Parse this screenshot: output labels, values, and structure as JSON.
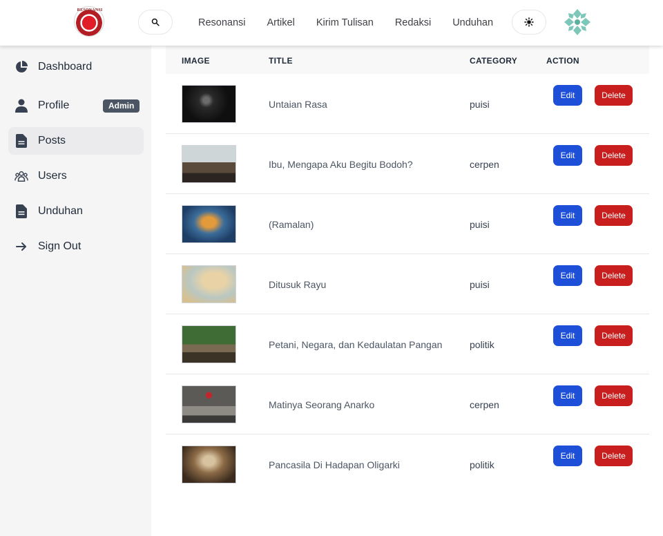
{
  "header": {
    "logo_text": "RESONANSI",
    "nav": [
      "Resonansi",
      "Artikel",
      "Kirim Tulisan",
      "Redaksi",
      "Unduhan"
    ],
    "icons": {
      "search": "search-icon",
      "theme": "sun-icon",
      "avatar": "avatar-icon"
    }
  },
  "sidebar": {
    "items": [
      {
        "label": "Dashboard",
        "icon": "pie-chart-icon"
      },
      {
        "label": "Profile",
        "icon": "user-icon",
        "badge": "Admin"
      },
      {
        "label": "Posts",
        "icon": "document-icon",
        "active": true
      },
      {
        "label": "Users",
        "icon": "users-icon"
      },
      {
        "label": "Unduhan",
        "icon": "file-icon"
      },
      {
        "label": "Sign Out",
        "icon": "arrow-right-icon"
      }
    ]
  },
  "table": {
    "headers": {
      "image": "IMAGE",
      "title": "TITLE",
      "category": "CATEGORY",
      "action": "ACTION"
    },
    "edit_label": "Edit",
    "delete_label": "Delete",
    "rows": [
      {
        "title": "Untaian Rasa",
        "category": "puisi"
      },
      {
        "title": "Ibu, Mengapa Aku Begitu Bodoh?",
        "category": "cerpen"
      },
      {
        "title": "(Ramalan)",
        "category": "puisi"
      },
      {
        "title": "Ditusuk Rayu",
        "category": "puisi"
      },
      {
        "title": "Petani, Negara, dan Kedaulatan Pangan",
        "category": "politik"
      },
      {
        "title": "Matinya Seorang Anarko",
        "category": "cerpen"
      },
      {
        "title": "Pancasila Di Hadapan Oligarki",
        "category": "politik"
      }
    ]
  },
  "colors": {
    "edit": "#1d4fd8",
    "delete": "#c81e1e",
    "badge": "#4b5563"
  }
}
